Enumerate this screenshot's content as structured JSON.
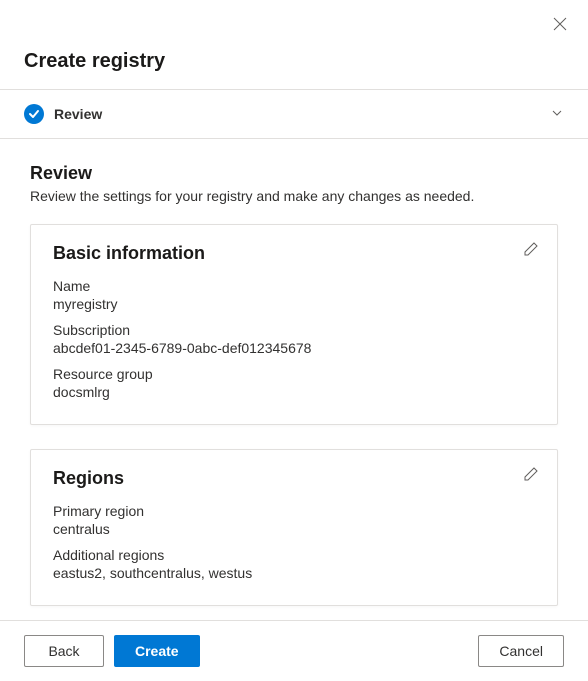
{
  "header": {
    "title": "Create registry"
  },
  "step": {
    "label": "Review"
  },
  "review": {
    "heading": "Review",
    "description": "Review the settings for your registry and make any changes as needed."
  },
  "basic": {
    "title": "Basic information",
    "name_label": "Name",
    "name_value": "myregistry",
    "subscription_label": "Subscription",
    "subscription_value": "abcdef01-2345-6789-0abc-def012345678",
    "rg_label": "Resource group",
    "rg_value": "docsmlrg"
  },
  "regions": {
    "title": "Regions",
    "primary_label": "Primary region",
    "primary_value": "centralus",
    "additional_label": "Additional regions",
    "additional_value": "eastus2, southcentralus, westus"
  },
  "footer": {
    "back": "Back",
    "create": "Create",
    "cancel": "Cancel"
  }
}
